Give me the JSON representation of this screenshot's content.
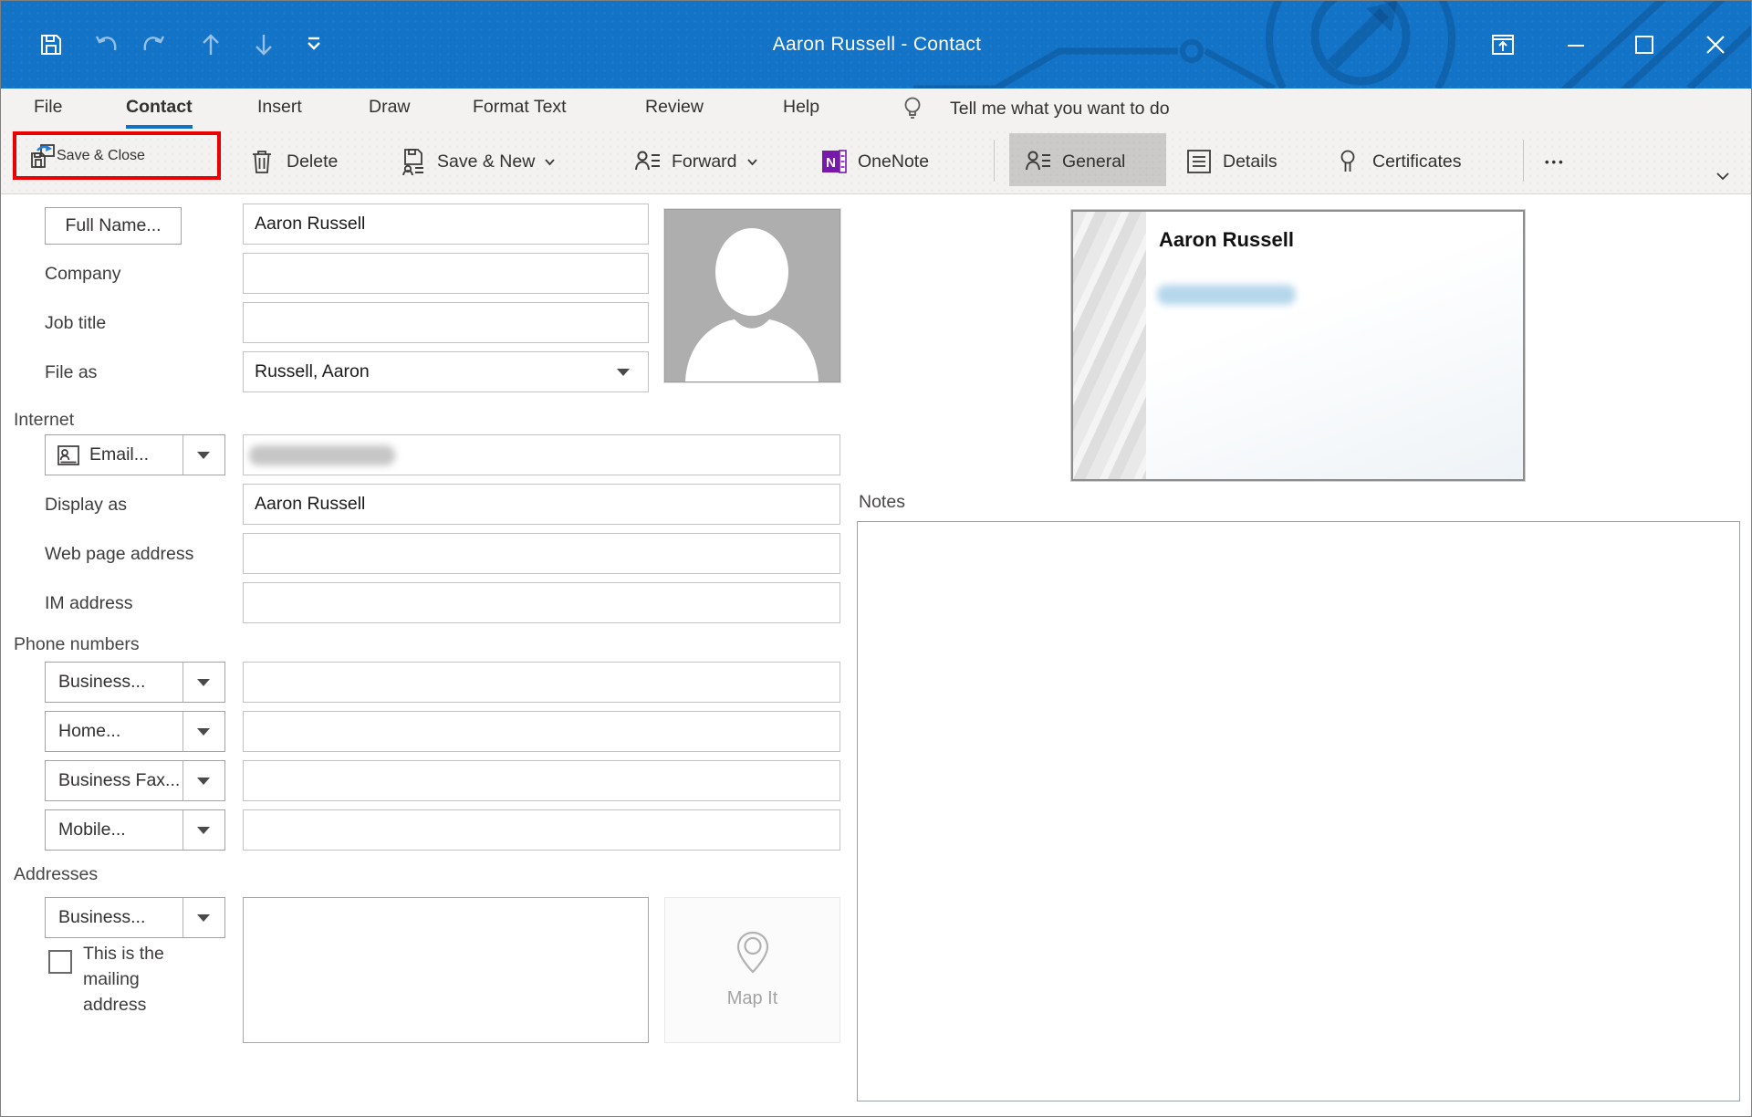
{
  "titlebar": {
    "title": "Aaron Russell - Contact",
    "icons": [
      "save-icon",
      "undo-icon",
      "redo-icon",
      "up-arrow-icon",
      "down-arrow-icon",
      "customize-qat-icon"
    ],
    "window_controls": [
      "popout-icon",
      "minimize-icon",
      "maximize-icon",
      "close-icon"
    ],
    "color": "#1373c6"
  },
  "menu": {
    "items": [
      {
        "label": "File",
        "selected": false
      },
      {
        "label": "Contact",
        "selected": true
      },
      {
        "label": "Insert",
        "selected": false
      },
      {
        "label": "Draw",
        "selected": false
      },
      {
        "label": "Format Text",
        "selected": false
      },
      {
        "label": "Review",
        "selected": false
      },
      {
        "label": "Help",
        "selected": false
      }
    ],
    "tell_me": "Tell me what you want to do"
  },
  "ribbon": {
    "save_close": "Save & Close",
    "delete": "Delete",
    "save_new": "Save & New",
    "forward": "Forward",
    "onenote": "OneNote",
    "general": "General",
    "details": "Details",
    "certificates": "Certificates",
    "more": "•••",
    "highlight_color": "#e90000",
    "selected_tab": "General"
  },
  "form": {
    "full_name_button": "Full Name...",
    "full_name_value": "Aaron Russell",
    "company_label": "Company",
    "company_value": "",
    "job_title_label": "Job title",
    "job_title_value": "",
    "file_as_label": "File as",
    "file_as_value": "Russell, Aaron",
    "internet_header": "Internet",
    "email_button": "Email...",
    "email_value_redacted": true,
    "display_as_label": "Display as",
    "display_as_value": "Aaron Russell",
    "web_label": "Web page address",
    "web_value": "",
    "im_label": "IM address",
    "im_value": "",
    "phone_header": "Phone numbers",
    "phones": [
      {
        "label": "Business...",
        "value": ""
      },
      {
        "label": "Home...",
        "value": ""
      },
      {
        "label": "Business Fax...",
        "value": ""
      },
      {
        "label": "Mobile...",
        "value": ""
      }
    ],
    "addresses_header": "Addresses",
    "address_type_button": "Business...",
    "address_value": "",
    "mailing_checkbox_label": "This is the mailing address",
    "mailing_checkbox_checked": false,
    "map_it": "Map It"
  },
  "card": {
    "name": "Aaron Russell",
    "email_redacted": true
  },
  "notes": {
    "label": "Notes",
    "value": ""
  },
  "colors": {
    "accent_blue": "#1271c3",
    "onenote_purple": "#7719aa",
    "ribbon_bg": "#f3f2f1"
  }
}
